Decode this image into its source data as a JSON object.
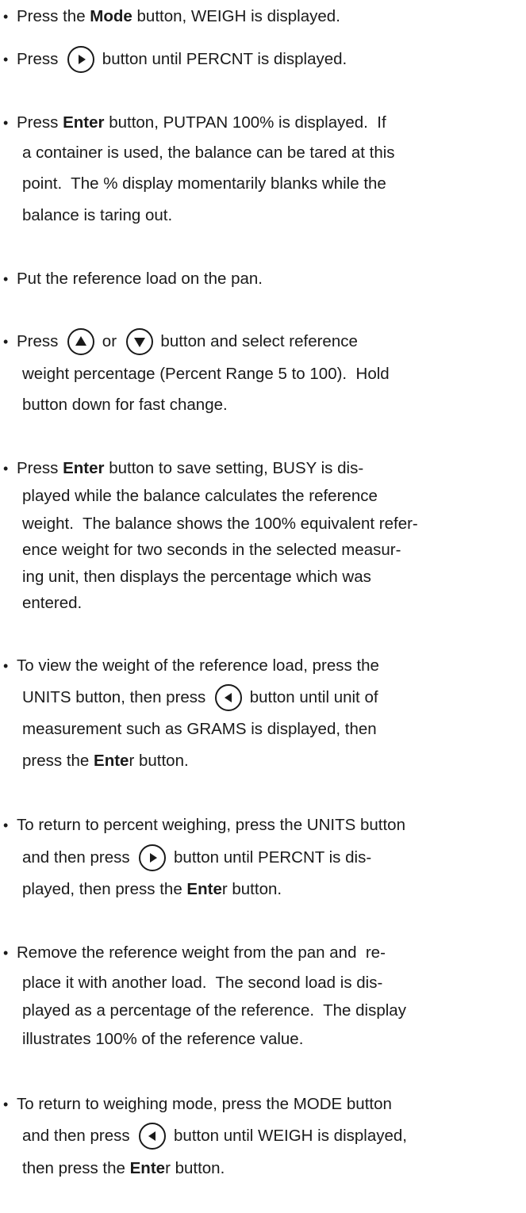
{
  "bullet": "•",
  "icons": {
    "right": "right-arrow-icon",
    "left": "left-arrow-icon",
    "up": "up-arrow-icon",
    "down": "down-arrow-icon"
  },
  "steps": [
    {
      "lines": [
        [
          "Press the ",
          {
            "b": "Mode"
          },
          " button, WEIGH is displayed."
        ]
      ]
    },
    {
      "lines": [
        [
          "Press ",
          {
            "icon": "right"
          },
          " button until PERCNT is displayed."
        ]
      ]
    },
    {
      "lines": [
        [
          "Press ",
          {
            "b": "Enter"
          },
          " button, PUTPAN 100% is displayed.  If"
        ],
        [
          "a container is used, the balance can be tared at this"
        ],
        [
          "point.  The % display momentarily blanks while the"
        ],
        [
          "balance is taring out."
        ]
      ]
    },
    {
      "lines": [
        [
          "Put the reference load on the pan."
        ]
      ]
    },
    {
      "lines": [
        [
          "Press ",
          {
            "icon": "up"
          },
          " or ",
          {
            "icon": "down"
          },
          " button and select reference"
        ],
        [
          "weight percentage (Percent Range 5 to 100).  Hold"
        ],
        [
          "button down for fast change."
        ]
      ]
    },
    {
      "lines": [
        [
          "Press ",
          {
            "b": "Enter"
          },
          " button to save setting, BUSY is dis-"
        ],
        [
          "played while the balance calculates the reference"
        ],
        [
          "weight.  The balance shows the 100% equivalent refer-"
        ],
        [
          "ence weight for two seconds in the selected measur-"
        ],
        [
          "ing unit, then displays the percentage which was"
        ],
        [
          "entered."
        ]
      ]
    },
    {
      "lines": [
        [
          "To view the weight of the reference load, press the"
        ],
        [
          "UNITS button, then press ",
          {
            "icon": "left"
          },
          " button until unit of"
        ],
        [
          "measurement such as GRAMS is displayed, then"
        ],
        [
          "press the ",
          {
            "b": "Ente"
          },
          "r button."
        ]
      ]
    },
    {
      "lines": [
        [
          "To return to percent weighing, press the UNITS button"
        ],
        [
          "and then press ",
          {
            "icon": "right"
          },
          " button until PERCNT is dis-"
        ],
        [
          "played, then press the ",
          {
            "b": "Ente"
          },
          "r button."
        ]
      ]
    },
    {
      "lines": [
        [
          "Remove the reference weight from the pan and  re-"
        ],
        [
          "place it with another load.  The second load is dis-"
        ],
        [
          "played as a percentage of the reference.  The display"
        ],
        [
          "illustrates 100% of the reference value."
        ]
      ]
    },
    {
      "lines": [
        [
          "To return to weighing mode, press the MODE button"
        ],
        [
          "and then press ",
          {
            "icon": "left"
          },
          " button until WEIGH is displayed,"
        ],
        [
          "then press the ",
          {
            "b": "Ente"
          },
          "r button."
        ]
      ]
    }
  ]
}
